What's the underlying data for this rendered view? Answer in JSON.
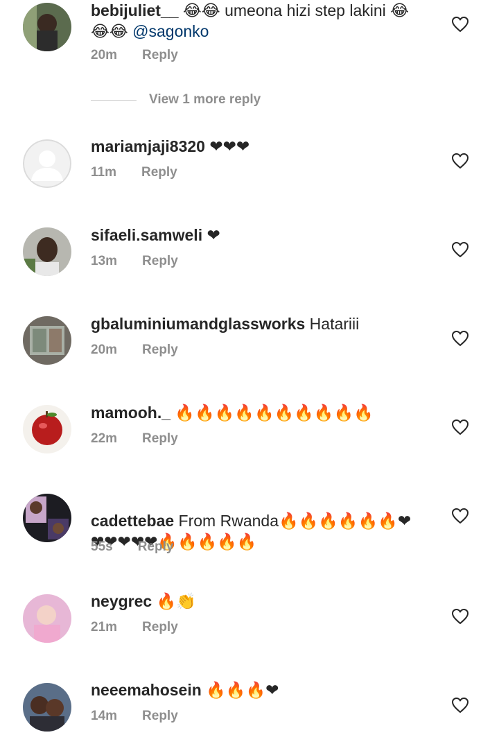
{
  "comments": [
    {
      "user": "bebijuliet__",
      "text": " 😂😂 umeona hizi step lakini 😂\n😂😂 ",
      "mention": "@sagonko",
      "time": "20m",
      "reply": "Reply"
    },
    {
      "user": "mariamjaji8320",
      "text": " ❤❤❤",
      "time": "11m",
      "reply": "Reply"
    },
    {
      "user": "sifaeli.samweli",
      "text": " ❤",
      "time": "13m",
      "reply": "Reply"
    },
    {
      "user": "gbaluminiumandglassworks",
      "text": " Hatariii",
      "time": "20m",
      "reply": "Reply"
    },
    {
      "user": "mamooh._",
      "text": " 🔥🔥🔥🔥🔥🔥🔥🔥🔥🔥",
      "time": "22m",
      "reply": "Reply"
    },
    {
      "user": "cadettebae",
      "text": " From Rwanda🔥🔥🔥🔥🔥🔥❤\n❤❤❤❤❤🔥🔥🔥🔥🔥",
      "time": "55s",
      "reply": "Reply"
    },
    {
      "user": "neygrec",
      "text": " 🔥👏",
      "time": "21m",
      "reply": "Reply"
    },
    {
      "user": "neeemahosein",
      "text": " 🔥🔥🔥❤",
      "time": "14m",
      "reply": "Reply"
    }
  ],
  "view_more": {
    "label": "View 1 more reply"
  },
  "icons": {
    "like": "heart-outline-icon",
    "default_avatar": "person-silhouette-icon"
  },
  "colors": {
    "mention": "#00376b",
    "meta": "#8e8e8e",
    "text": "#262626"
  }
}
